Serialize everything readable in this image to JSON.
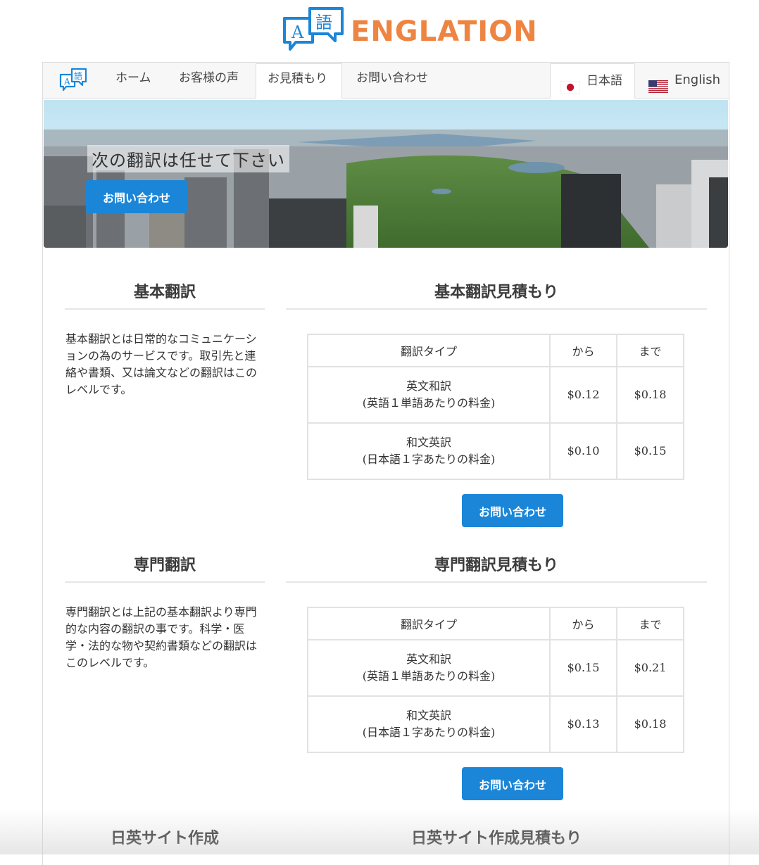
{
  "brand": {
    "name": "ENGLATION",
    "icon_glyph_a": "A",
    "icon_glyph_b": "語"
  },
  "nav": {
    "items": [
      {
        "label": "ホーム"
      },
      {
        "label": "お客様の声"
      },
      {
        "label": "お見積もり",
        "active": true
      },
      {
        "label": "お問い合わせ"
      }
    ],
    "languages": [
      {
        "label": "日本語",
        "flag": "jp-flag",
        "active": true
      },
      {
        "label": "English",
        "flag": "us-flag",
        "active": false
      }
    ]
  },
  "hero": {
    "title": "次の翻訳は任せて下さい",
    "button": "お問い合わせ"
  },
  "sections": [
    {
      "title": "基本翻訳",
      "quote_title": "基本翻訳見積もり",
      "description": "基本翻訳とは日常的なコミュニケーションの為のサービスです。取引先と連絡や書類、又は論文などの翻訳はこのレベルです。",
      "table": {
        "headers": [
          "翻訳タイプ",
          "から",
          "まで"
        ],
        "rows": [
          {
            "type": "英文和訳",
            "note": "(英語１単語あたりの料金)",
            "from": "$0.12",
            "to": "$0.18"
          },
          {
            "type": "和文英訳",
            "note": "(日本語１字あたりの料金)",
            "from": "$0.10",
            "to": "$0.15"
          }
        ]
      },
      "button": "お問い合わせ"
    },
    {
      "title": "専門翻訳",
      "quote_title": "専門翻訳見積もり",
      "description": "専門翻訳とは上記の基本翻訳より専門的な内容の翻訳の事です。科学・医学・法的な物や契約書類などの翻訳はこのレベルです。",
      "table": {
        "headers": [
          "翻訳タイプ",
          "から",
          "まで"
        ],
        "rows": [
          {
            "type": "英文和訳",
            "note": "(英語１単語あたりの料金)",
            "from": "$0.15",
            "to": "$0.21"
          },
          {
            "type": "和文英訳",
            "note": "(日本語１字あたりの料金)",
            "from": "$0.13",
            "to": "$0.18"
          }
        ]
      },
      "button": "お問い合わせ"
    },
    {
      "title": "日英サイト作成",
      "quote_title": "日英サイト作成見積もり"
    }
  ],
  "colors": {
    "brand_orange": "#ee8442",
    "brand_blue": "#1b86d8",
    "button_blue": "#1b86d8"
  }
}
